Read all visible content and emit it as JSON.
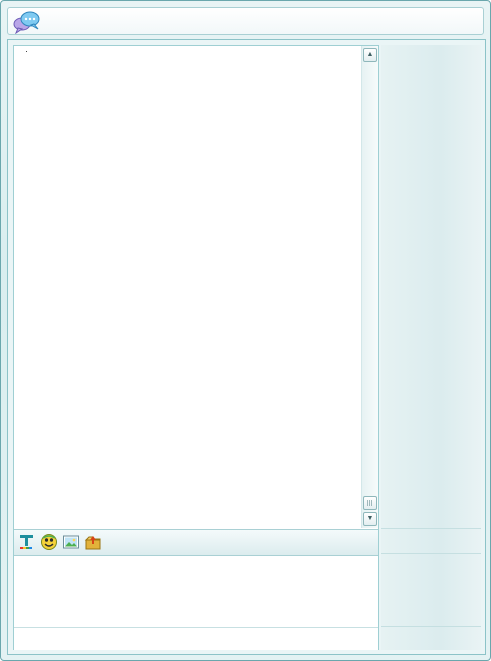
{
  "window": {
    "title": ""
  },
  "icons": {
    "app": "chat-bubbles-icon",
    "font": "text-format-icon",
    "emoticon": "emoticon-icon",
    "image": "picture-icon",
    "file": "send-file-icon"
  },
  "colors": {
    "frame_border": "#6aa7ad",
    "frame_bg": "#e3f2f3",
    "panel_border": "#9fcfd3"
  },
  "chat": {
    "history_text": "",
    "input_text": ""
  },
  "scrollbar": {
    "up_arrow": "▲",
    "down_arrow": "▼"
  }
}
